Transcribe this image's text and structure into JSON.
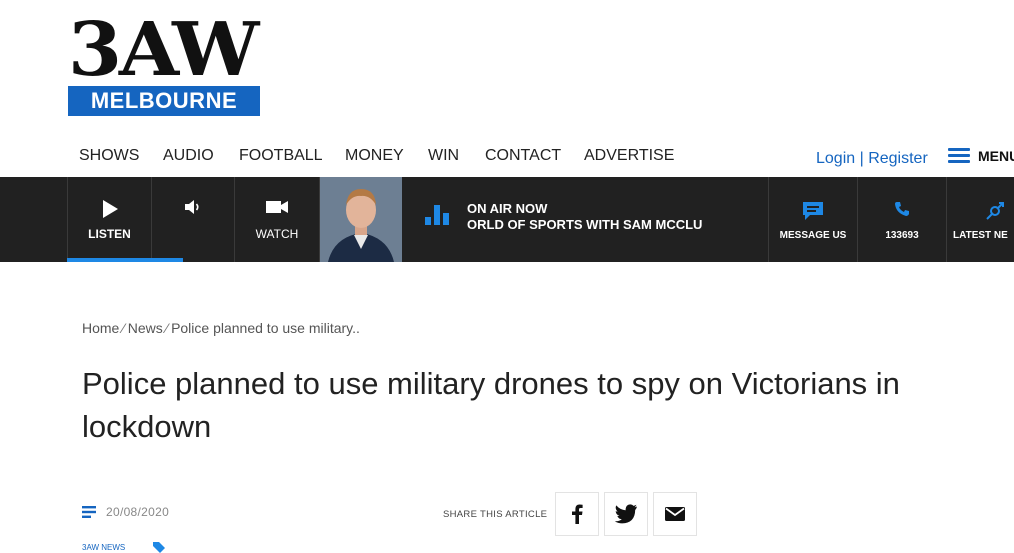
{
  "logo": {
    "top": "3AW",
    "bottom": "MELBOURNE"
  },
  "nav": {
    "items": [
      "SHOWS",
      "AUDIO",
      "FOOTBALL",
      "MONEY",
      "WIN",
      "CONTACT",
      "ADVERTISE"
    ],
    "auth": "Login | Register",
    "menu_label": "MENU"
  },
  "player": {
    "listen": "LISTEN",
    "watch": "WATCH",
    "on_air_title": "ON AIR NOW",
    "on_air_show": "ORLD OF SPORTS WITH SAM MCCLU",
    "message": "MESSAGE US",
    "phone": "133693",
    "latest": "LATEST NE"
  },
  "article": {
    "breadcrumb": [
      "Home",
      "News",
      "Police planned to use military.."
    ],
    "headline": "Police planned to use military drones to spy on Victorians in lockdown",
    "date": "20/08/2020",
    "share_label": "SHARE THIS ARTICLE",
    "category": "3AW NEWS"
  },
  "colors": {
    "accent": "#1565c0",
    "bar": "#212121",
    "underline": "#1e88e5"
  }
}
